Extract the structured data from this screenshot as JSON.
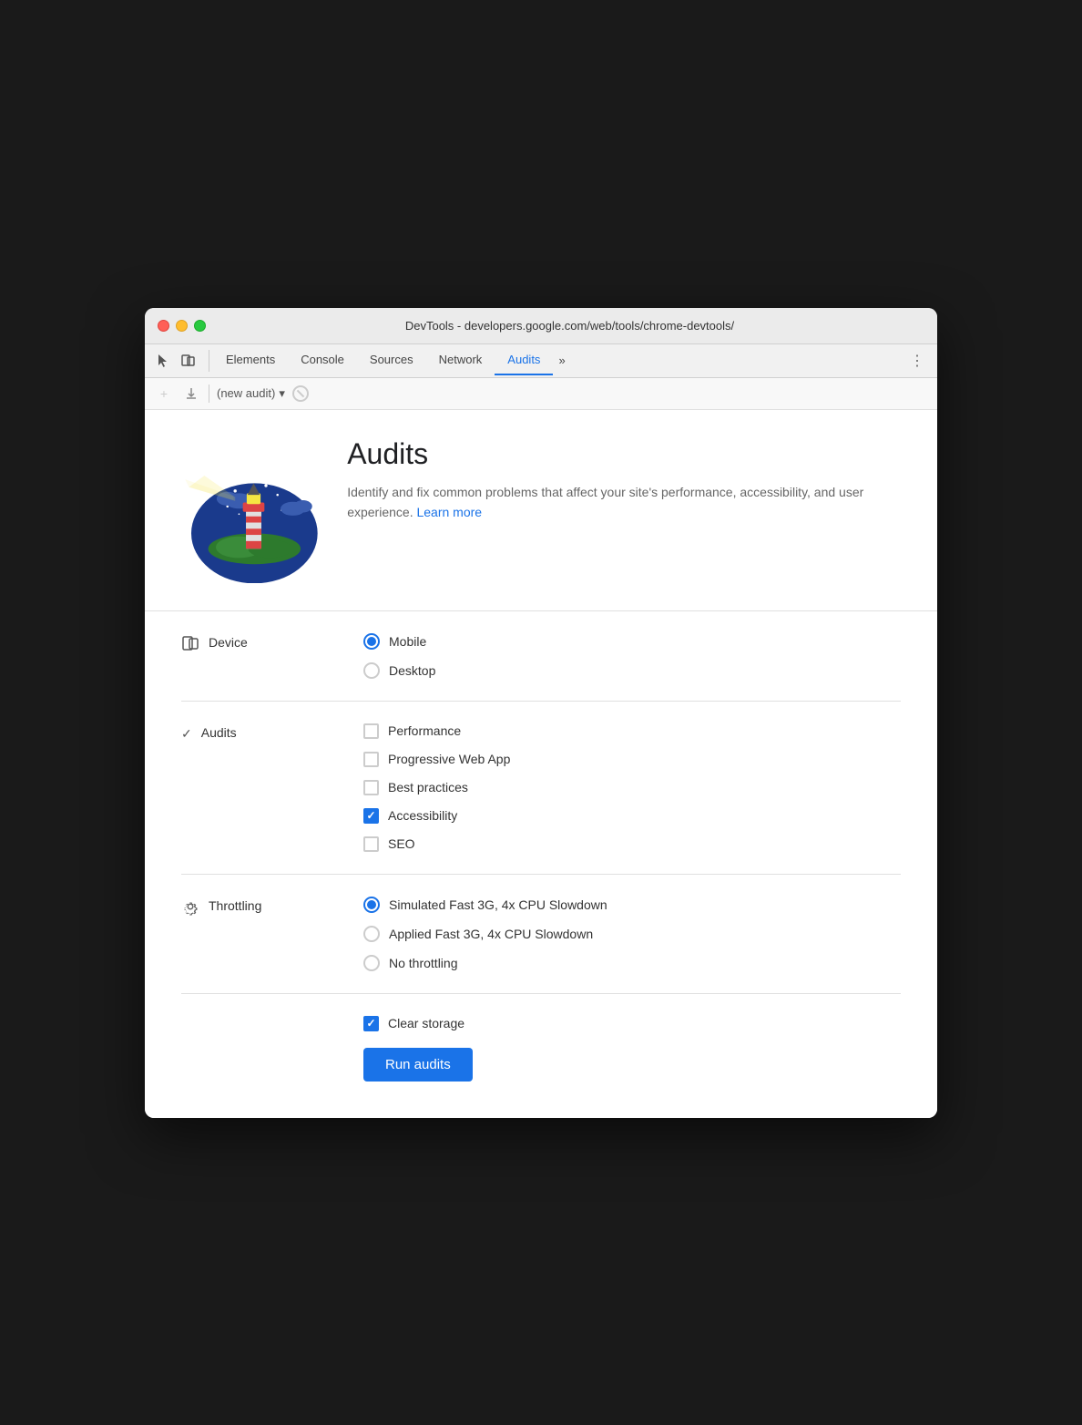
{
  "window": {
    "title": "DevTools - developers.google.com/web/tools/chrome-devtools/"
  },
  "tabs": {
    "items": [
      {
        "id": "elements",
        "label": "Elements",
        "active": false
      },
      {
        "id": "console",
        "label": "Console",
        "active": false
      },
      {
        "id": "sources",
        "label": "Sources",
        "active": false
      },
      {
        "id": "network",
        "label": "Network",
        "active": false
      },
      {
        "id": "audits",
        "label": "Audits",
        "active": true
      }
    ],
    "more_label": "»",
    "menu_icon": "⋮"
  },
  "toolbar": {
    "new_audit_placeholder": "(new audit)"
  },
  "hero": {
    "title": "Audits",
    "description": "Identify and fix common problems that affect your site's performance, accessibility, and user experience.",
    "learn_more_label": "Learn more"
  },
  "device_section": {
    "label": "Device",
    "options": [
      {
        "id": "mobile",
        "label": "Mobile",
        "checked": true
      },
      {
        "id": "desktop",
        "label": "Desktop",
        "checked": false
      }
    ]
  },
  "audits_section": {
    "label": "Audits",
    "options": [
      {
        "id": "performance",
        "label": "Performance",
        "checked": false
      },
      {
        "id": "pwa",
        "label": "Progressive Web App",
        "checked": false
      },
      {
        "id": "best-practices",
        "label": "Best practices",
        "checked": false
      },
      {
        "id": "accessibility",
        "label": "Accessibility",
        "checked": true
      },
      {
        "id": "seo",
        "label": "SEO",
        "checked": false
      }
    ]
  },
  "throttling_section": {
    "label": "Throttling",
    "options": [
      {
        "id": "simulated",
        "label": "Simulated Fast 3G, 4x CPU Slowdown",
        "checked": true
      },
      {
        "id": "applied",
        "label": "Applied Fast 3G, 4x CPU Slowdown",
        "checked": false
      },
      {
        "id": "none",
        "label": "No throttling",
        "checked": false
      }
    ]
  },
  "storage_section": {
    "options": [
      {
        "id": "clear-storage",
        "label": "Clear storage",
        "checked": true
      }
    ]
  },
  "run_button": {
    "label": "Run audits"
  }
}
